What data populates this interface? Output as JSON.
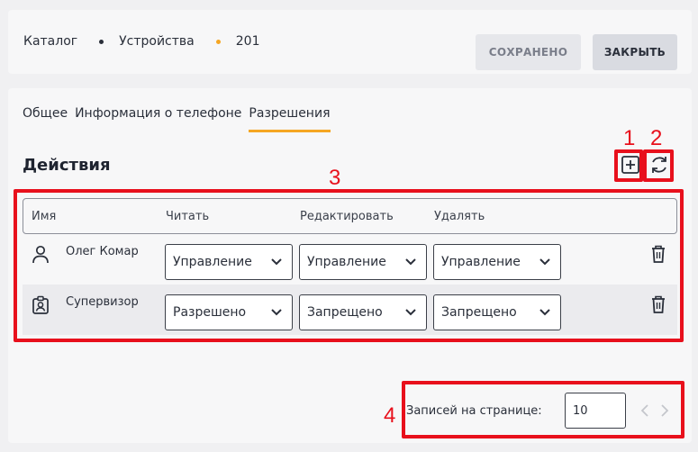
{
  "breadcrumb": {
    "items": [
      "Каталог",
      "Устройства",
      "201"
    ],
    "dot_colors": [
      "#2a2f3a",
      "#f5a623"
    ]
  },
  "header_buttons": {
    "saved_label": "СОХРАНЕНО",
    "close_label": "ЗАКРЫТЬ"
  },
  "tabs": [
    {
      "label": "Общее",
      "active": false
    },
    {
      "label": "Информация о телефоне",
      "active": false
    },
    {
      "label": "Разрешения",
      "active": true
    }
  ],
  "section": {
    "title": "Действия",
    "add_icon": "plus-square-icon",
    "refresh_icon": "refresh-icon"
  },
  "table": {
    "columns": [
      "Имя",
      "Читать",
      "Редактировать",
      "Удалять"
    ],
    "rows": [
      {
        "icon": "user-icon",
        "name": "Олег Комар",
        "read": "Управление",
        "edit": "Управление",
        "delete": "Управление"
      },
      {
        "icon": "badge-icon",
        "name": "Супервизор",
        "read": "Разрешено",
        "edit": "Запрещено",
        "delete": "Запрещено"
      }
    ]
  },
  "pagination": {
    "label": "Записей на странице:",
    "per_page": "10"
  },
  "annotations": [
    "1",
    "2",
    "3",
    "4"
  ],
  "colors": {
    "accent": "#f5a623",
    "annotation": "#e8101c"
  }
}
